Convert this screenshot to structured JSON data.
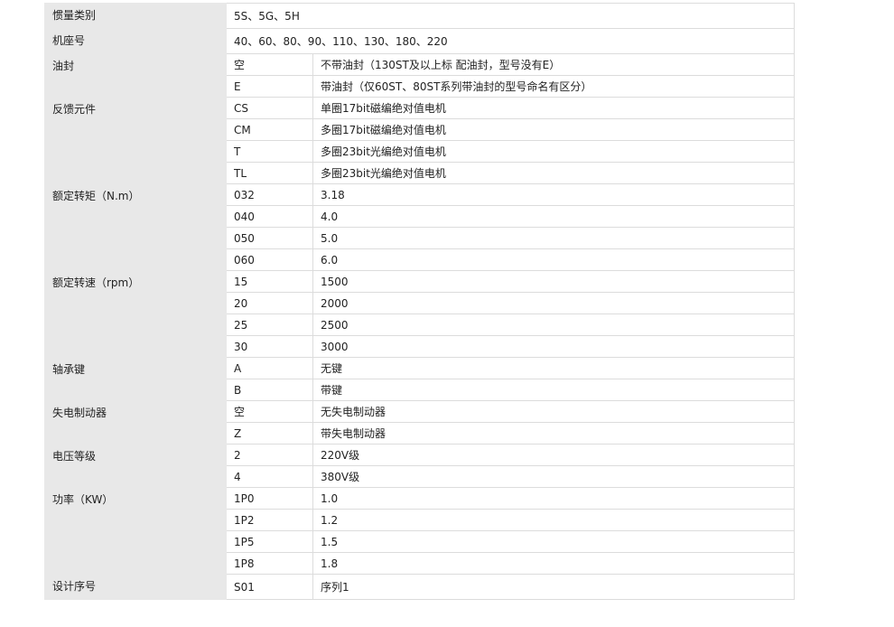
{
  "rows": [
    {
      "category": "惯量类别",
      "code": "5S、5G、5H",
      "desc": null,
      "span": 1
    },
    {
      "category": "机座号",
      "code": "40、60、80、90、110、130、180、220",
      "desc": null,
      "span": 1
    },
    {
      "category": "油封",
      "span": 2,
      "items": [
        {
          "code": "空",
          "desc": "不带油封（130ST及以上标 配油封，型号没有E）"
        },
        {
          "code": "E",
          "desc": "带油封（仅60ST、80ST系列带油封的型号命名有区分）"
        }
      ]
    },
    {
      "category": "反馈元件",
      "span": 4,
      "items": [
        {
          "code": "CS",
          "desc": "单圈17bit磁编绝对值电机"
        },
        {
          "code": "CM",
          "desc": "多圈17bit磁编绝对值电机"
        },
        {
          "code": "T",
          "desc": "多圈23bit光编绝对值电机"
        },
        {
          "code": "TL",
          "desc": "多圈23bit光编绝对值电机"
        }
      ]
    },
    {
      "category": "额定转矩（N.m）",
      "span": 4,
      "items": [
        {
          "code": "032",
          "desc": "3.18"
        },
        {
          "code": "040",
          "desc": "4.0"
        },
        {
          "code": "050",
          "desc": "5.0"
        },
        {
          "code": "060",
          "desc": "6.0"
        }
      ]
    },
    {
      "category": "额定转速（rpm）",
      "span": 4,
      "items": [
        {
          "code": "15",
          "desc": "1500"
        },
        {
          "code": "20",
          "desc": "2000"
        },
        {
          "code": "25",
          "desc": "2500"
        },
        {
          "code": "30",
          "desc": "3000"
        }
      ]
    },
    {
      "category": "轴承键",
      "span": 2,
      "items": [
        {
          "code": "A",
          "desc": "无键"
        },
        {
          "code": "B",
          "desc": "带键"
        }
      ]
    },
    {
      "category": "失电制动器",
      "span": 2,
      "items": [
        {
          "code": "空",
          "desc": "无失电制动器"
        },
        {
          "code": "Z",
          "desc": "带失电制动器"
        }
      ]
    },
    {
      "category": "电压等级",
      "span": 2,
      "items": [
        {
          "code": "2",
          "desc": "220V级"
        },
        {
          "code": "4",
          "desc": "380V级"
        }
      ]
    },
    {
      "category": "功率（KW）",
      "span": 4,
      "items": [
        {
          "code": "1P0",
          "desc": "1.0"
        },
        {
          "code": "1P2",
          "desc": "1.2"
        },
        {
          "code": "1P5",
          "desc": "1.5"
        },
        {
          "code": "1P8",
          "desc": "1.8"
        }
      ]
    },
    {
      "category": "设计序号",
      "span": 1,
      "items": [
        {
          "code": "S01",
          "desc": "序列1"
        }
      ]
    }
  ]
}
